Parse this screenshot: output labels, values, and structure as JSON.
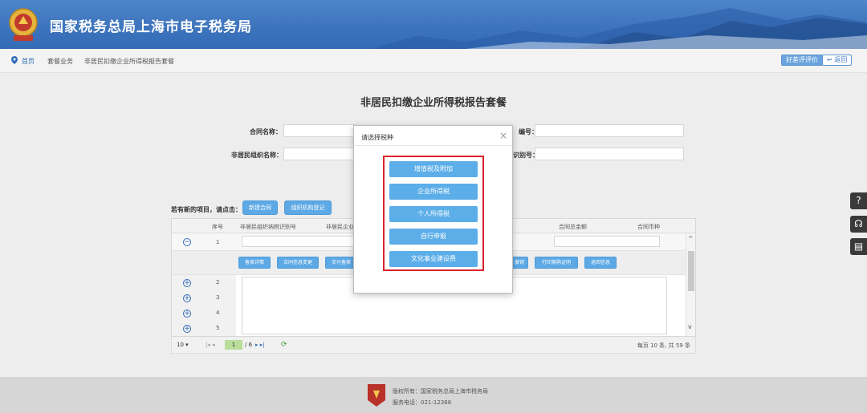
{
  "header": {
    "title": "国家税务总局上海市电子税务局",
    "emblem_text": "中国税务"
  },
  "breadcrumb": [
    "首页",
    "套餐业务",
    "非居民扣缴企业所得税报告套餐"
  ],
  "topbar": {
    "rate_btn": "好差评评价",
    "return_btn": "返回"
  },
  "page": {
    "title": "非居民扣缴企业所得税报告套餐",
    "fields": {
      "contract_name": "合同名称：",
      "contract_no": "编号：",
      "org_name": "非居民组织名称：",
      "org_code": "识别号："
    },
    "new_items_label": "若有新的项目，请点击：",
    "new_contract_btn": "新建合同",
    "org_register_btn": "组织机构登记"
  },
  "grid": {
    "headers": [
      "序号",
      "非居民组织纳税识别号",
      "非居民企业",
      "合同总金额",
      "合同币种"
    ],
    "rows": [
      "1",
      "2",
      "3",
      "4",
      "5"
    ],
    "actions": [
      "备案详情",
      "合同信息变更",
      "支付备案",
      "撤销",
      "打印换购证明",
      "退回信息"
    ],
    "pager": {
      "page_size": "10",
      "current": "1",
      "total_pages": "/ 6",
      "summary": "每页 10 条, 共 59 条"
    }
  },
  "dialog": {
    "title": "请选择税种",
    "close": "×",
    "options": [
      "增值税及附加",
      "企业所得税",
      "个人所得税",
      "自行申报",
      "文化事业建设费"
    ]
  },
  "footer": {
    "copyright": "版权所有：国家税务总局上海市税务局",
    "phone": "服务电话：021-12366"
  },
  "colors": {
    "header": "#3d74bd",
    "button": "#5caee9",
    "highlight": "#d9232c"
  },
  "icons": [
    "location-pin-icon",
    "help-icon",
    "headset-icon",
    "document-icon",
    "refresh-icon"
  ]
}
